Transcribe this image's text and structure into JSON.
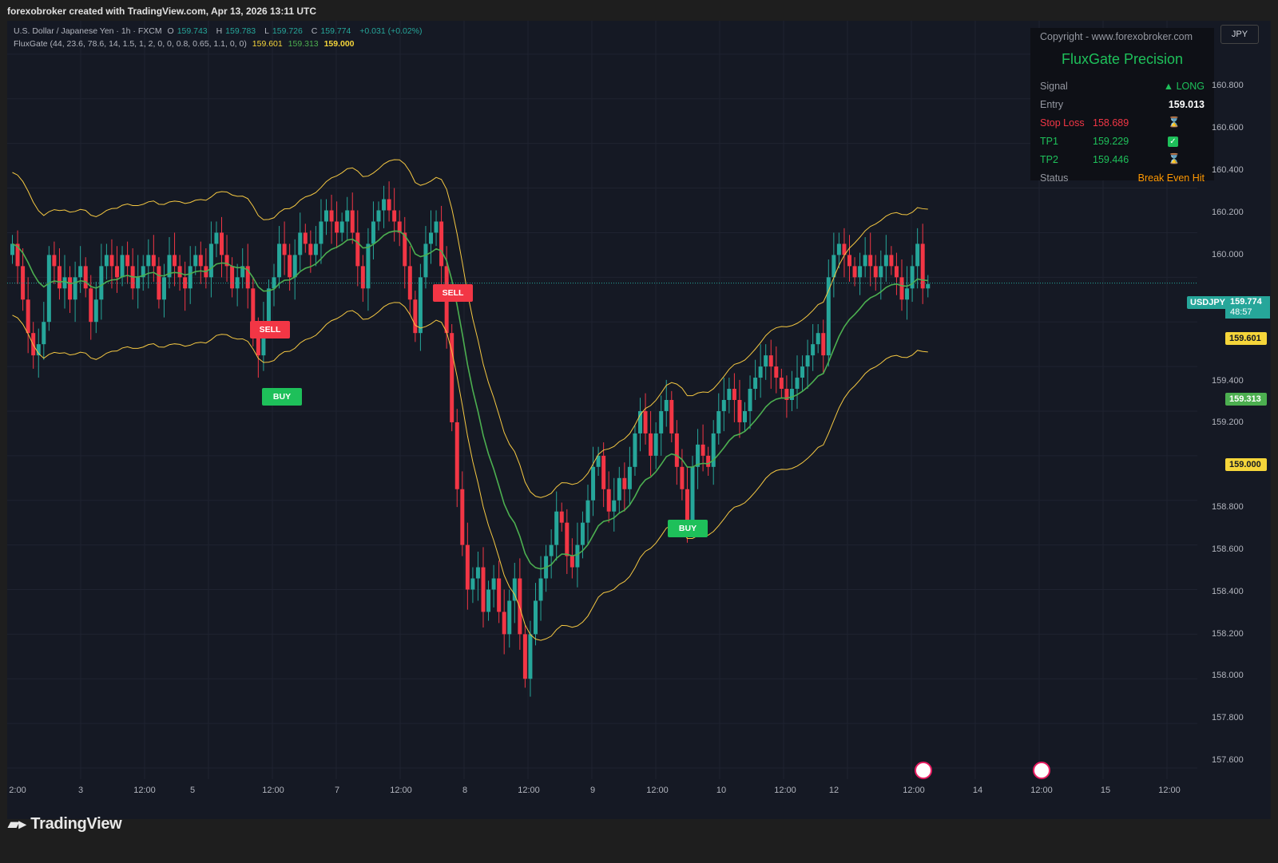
{
  "header": {
    "caption": "forexobroker created with TradingView.com, Apr 13, 2026 13:11 UTC"
  },
  "legend": {
    "symbol": "U.S. Dollar / Japanese Yen · 1h · FXCM",
    "o_label": "O",
    "o": "159.743",
    "h_label": "H",
    "h": "159.783",
    "l_label": "L",
    "l": "159.726",
    "c_label": "C",
    "c": "159.774",
    "change": "+0.031 (+0.02%)",
    "indicator": "FluxGate (44, 23.6, 78.6, 14, 1.5, 1, 2, 0, 0, 0.8, 0.65, 1.1, 0, 0)",
    "ind_v1": "159.601",
    "ind_v2": "159.313",
    "ind_v3": "159.000"
  },
  "currency_button": "JPY",
  "info_panel": {
    "copyright": "Copyright - www.forexobroker.com",
    "title": "FluxGate Precision",
    "signal_label": "Signal",
    "signal_value": "▲ LONG",
    "entry_label": "Entry",
    "entry_value": "159.013",
    "sl_label": "Stop Loss",
    "sl_value": "158.689",
    "sl_icon": "⌛",
    "tp1_label": "TP1",
    "tp1_value": "159.229",
    "tp1_icon": "✓",
    "tp2_label": "TP2",
    "tp2_value": "159.446",
    "tp2_icon": "⌛",
    "status_label": "Status",
    "status_value": "Break Even Hit"
  },
  "price_axis": [
    "160.800",
    "160.600",
    "160.400",
    "160.200",
    "160.000",
    "159.400",
    "159.200",
    "158.800",
    "158.600",
    "158.400",
    "158.200",
    "158.000",
    "157.800",
    "157.600"
  ],
  "time_axis": [
    "2:00",
    "3",
    "12:00",
    "5",
    "12:00",
    "7",
    "12:00",
    "8",
    "12:00",
    "9",
    "12:00",
    "10",
    "12:00",
    "12",
    "12:00",
    "14",
    "12:00",
    "15",
    "12:00"
  ],
  "price_tags": {
    "symbol": "USDJPY",
    "last": "159.774",
    "countdown": "48:57",
    "ind1": "159.601",
    "ind2": "159.313",
    "ind3": "159.000"
  },
  "signals": {
    "sell1": "SELL",
    "buy1": "BUY",
    "sell2": "SELL",
    "buy2": "BUY"
  },
  "colors": {
    "up": "#26a69a",
    "down": "#f23645",
    "mid_line": "#4caf50",
    "band": "#f5c842",
    "stop": "#f23645",
    "panel_green": "#1ec05a"
  },
  "footer": {
    "brand": "TradingView"
  },
  "chart_data": {
    "type": "candlestick",
    "symbol": "USDJPY",
    "timeframe": "1h",
    "ylim": [
      157.55,
      160.95
    ],
    "closes": [
      159.95,
      159.85,
      159.7,
      159.55,
      159.45,
      159.5,
      159.6,
      159.9,
      159.85,
      159.75,
      159.8,
      159.7,
      159.8,
      159.85,
      159.75,
      159.6,
      159.7,
      159.85,
      159.9,
      159.85,
      159.8,
      159.9,
      159.85,
      159.75,
      159.8,
      159.85,
      159.9,
      159.85,
      159.7,
      159.8,
      159.9,
      159.85,
      159.8,
      159.75,
      159.85,
      159.9,
      159.85,
      159.8,
      159.95,
      160.0,
      159.9,
      159.85,
      159.75,
      159.8,
      159.85,
      159.75,
      159.55,
      159.45,
      159.6,
      159.75,
      159.8,
      159.95,
      159.9,
      159.8,
      159.9,
      160.0,
      159.95,
      159.9,
      159.95,
      160.05,
      160.1,
      160.05,
      160.0,
      160.05,
      160.1,
      160.0,
      159.85,
      159.75,
      159.95,
      160.05,
      160.1,
      160.15,
      160.1,
      160.05,
      160.0,
      159.85,
      159.7,
      159.55,
      159.8,
      159.95,
      160.0,
      160.05,
      159.85,
      159.55,
      159.15,
      158.85,
      158.6,
      158.4,
      158.45,
      158.5,
      158.3,
      158.4,
      158.45,
      158.3,
      158.2,
      158.35,
      158.45,
      158.2,
      158.0,
      158.2,
      158.35,
      158.45,
      158.55,
      158.6,
      158.75,
      158.7,
      158.55,
      158.5,
      158.6,
      158.7,
      158.8,
      158.95,
      159.0,
      158.85,
      158.75,
      158.8,
      158.9,
      158.85,
      158.95,
      159.1,
      159.2,
      159.1,
      159.0,
      159.1,
      159.2,
      159.25,
      159.1,
      158.95,
      158.85,
      158.7,
      158.95,
      159.05,
      159.0,
      158.95,
      159.1,
      159.2,
      159.25,
      159.3,
      159.25,
      159.15,
      159.2,
      159.3,
      159.35,
      159.4,
      159.45,
      159.4,
      159.35,
      159.3,
      159.25,
      159.3,
      159.35,
      159.4,
      159.45,
      159.5,
      159.55,
      159.45,
      159.8,
      159.9,
      159.95,
      159.9,
      159.85,
      159.8,
      159.85,
      159.9,
      159.85,
      159.8,
      159.85,
      159.9,
      159.85,
      159.8,
      159.7,
      159.75,
      159.85,
      159.95,
      159.75,
      159.77
    ]
  }
}
